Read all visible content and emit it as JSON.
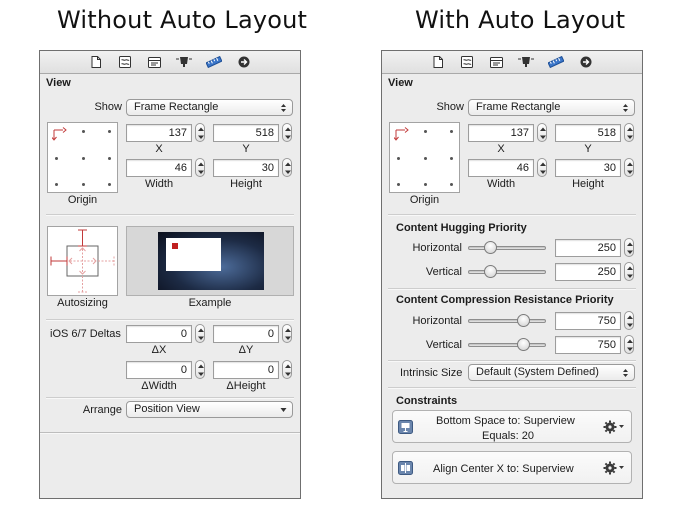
{
  "headings": {
    "left": "Without Auto Layout",
    "right": "With Auto Layout"
  },
  "tab_icons": [
    "file-icon",
    "quick-help-icon",
    "identity-icon",
    "attributes-icon",
    "size-ruler-icon",
    "connections-arrow-icon"
  ],
  "accent_color": "#3b76c9",
  "view_label": "View",
  "show": {
    "label": "Show",
    "value": "Frame Rectangle"
  },
  "frame": {
    "x": {
      "value": "137",
      "label": "X"
    },
    "y": {
      "value": "518",
      "label": "Y"
    },
    "width": {
      "value": "46",
      "label": "Width"
    },
    "height": {
      "value": "30",
      "label": "Height"
    },
    "origin_label": "Origin"
  },
  "autosizing": {
    "label": "Autosizing",
    "example_label": "Example"
  },
  "deltas": {
    "label": "iOS 6/7 Deltas",
    "dx": {
      "value": "0",
      "label": "ΔX"
    },
    "dy": {
      "value": "0",
      "label": "ΔY"
    },
    "dwidth": {
      "value": "0",
      "label": "ΔWidth"
    },
    "dheight": {
      "value": "0",
      "label": "ΔHeight"
    }
  },
  "arrange": {
    "label": "Arrange",
    "value": "Position View"
  },
  "hugging": {
    "title": "Content Hugging Priority",
    "horizontal": {
      "label": "Horizontal",
      "value": "250",
      "fraction": 0.25
    },
    "vertical": {
      "label": "Vertical",
      "value": "250",
      "fraction": 0.25
    }
  },
  "compression": {
    "title": "Content Compression Resistance Priority",
    "horizontal": {
      "label": "Horizontal",
      "value": "750",
      "fraction": 0.75
    },
    "vertical": {
      "label": "Vertical",
      "value": "750",
      "fraction": 0.75
    }
  },
  "intrinsic": {
    "label": "Intrinsic Size",
    "value": "Default (System Defined)"
  },
  "constraints": {
    "title": "Constraints",
    "items": [
      {
        "label": "Bottom Space to:",
        "target": "Superview",
        "equals_label": "Equals:",
        "equals_value": "20",
        "icon": "bottom-space-constraint-icon"
      },
      {
        "label": "Align Center X to:",
        "target": "Superview",
        "icon": "align-center-x-constraint-icon"
      }
    ]
  }
}
